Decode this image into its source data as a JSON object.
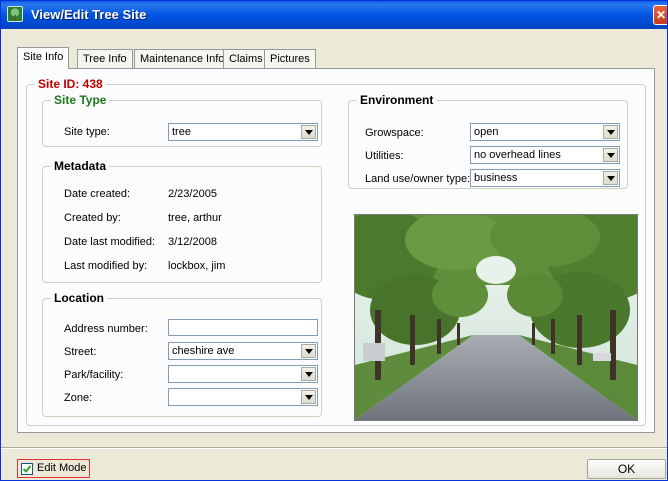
{
  "window": {
    "title": "View/Edit Tree Site"
  },
  "tabs": [
    {
      "label": "Site Info",
      "active": true
    },
    {
      "label": "Tree Info",
      "active": false
    },
    {
      "label": "Maintenance Info",
      "active": false
    },
    {
      "label": "Claims",
      "active": false
    },
    {
      "label": "Pictures",
      "active": false
    }
  ],
  "site_id": {
    "legend": "Site ID: 438"
  },
  "site_type": {
    "legend": "Site Type",
    "label": "Site type:",
    "value": "tree"
  },
  "metadata": {
    "legend": "Metadata",
    "rows": [
      {
        "label": "Date created:",
        "value": "2/23/2005"
      },
      {
        "label": "Created by:",
        "value": "tree, arthur"
      },
      {
        "label": "Date last modified:",
        "value": "3/12/2008"
      },
      {
        "label": "Last modified by:",
        "value": "lockbox, jim"
      }
    ]
  },
  "location": {
    "legend": "Location",
    "address_label": "Address number:",
    "address_value": "",
    "street_label": "Street:",
    "street_value": "cheshire ave",
    "park_label": "Park/facility:",
    "park_value": "",
    "zone_label": "Zone:",
    "zone_value": ""
  },
  "environment": {
    "legend": "Environment",
    "growspace_label": "Growspace:",
    "growspace_value": "open",
    "utilities_label": "Utilities:",
    "utilities_value": "no overhead lines",
    "landuse_label": "Land use/owner type:",
    "landuse_value": "business"
  },
  "footer": {
    "edit_mode_label": "Edit Mode",
    "edit_mode_checked": true,
    "ok_label": "OK"
  },
  "colors": {
    "titlebar": "#0054e3",
    "site_id_legend": "#c00000",
    "site_type_legend": "#1b7a1b",
    "edit_mode_outline": "#e1322b"
  },
  "icons": {
    "app": "tree-icon",
    "close": "close-icon",
    "dropdown": "chevron-down-icon",
    "check": "checkmark-icon"
  }
}
